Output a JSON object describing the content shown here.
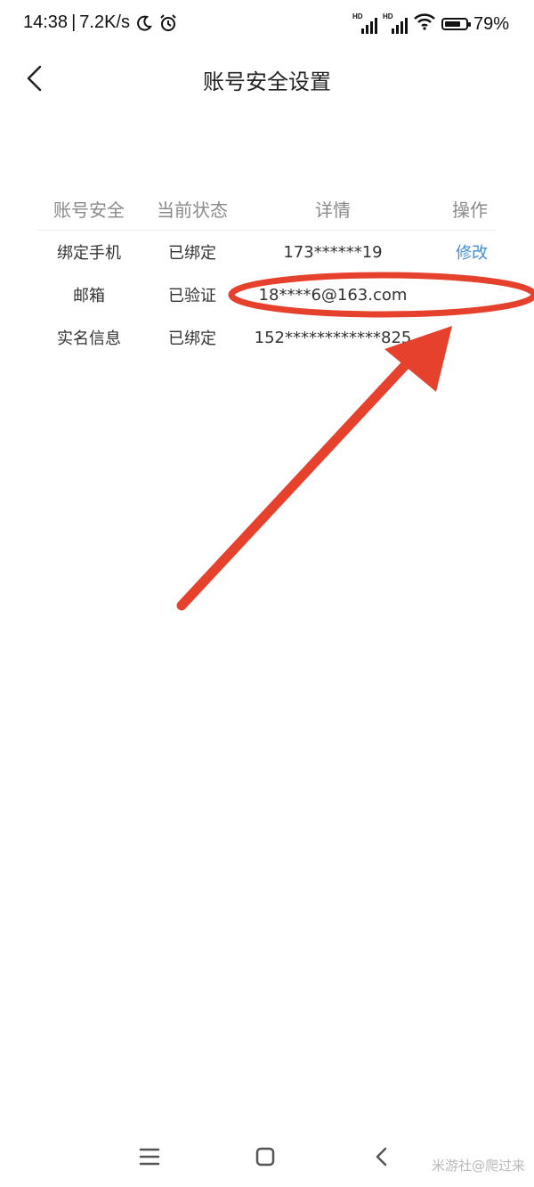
{
  "status_bar": {
    "time": "14:38",
    "separator": "|",
    "net_speed": "7.2K/s",
    "battery_percent": "79%",
    "battery_level": 0.79,
    "signal_1_label": "HD",
    "signal_2_label": "HD",
    "icons": [
      "moon-icon",
      "alarm-icon",
      "signal-icon",
      "wifi-icon",
      "battery-icon"
    ]
  },
  "header": {
    "title": "账号安全设置",
    "back_icon": "chevron-left-icon"
  },
  "table": {
    "headers": [
      "账号安全",
      "当前状态",
      "详情",
      "操作"
    ],
    "rows": [
      {
        "item": "绑定手机",
        "status": "已绑定",
        "detail": "173******19",
        "action": "修改"
      },
      {
        "item": "邮箱",
        "status": "已验证",
        "detail": "18****6@163.com",
        "action": ""
      },
      {
        "item": "实名信息",
        "status": "已绑定",
        "detail": "152************825",
        "action": ""
      }
    ]
  },
  "annotation": {
    "color": "#e5412d",
    "shapes": [
      "ellipse-highlight",
      "arrow"
    ]
  },
  "nav_bar": {
    "icons": [
      "menu-icon",
      "home-icon",
      "back-icon"
    ]
  },
  "watermark": "米游社@爬过来"
}
